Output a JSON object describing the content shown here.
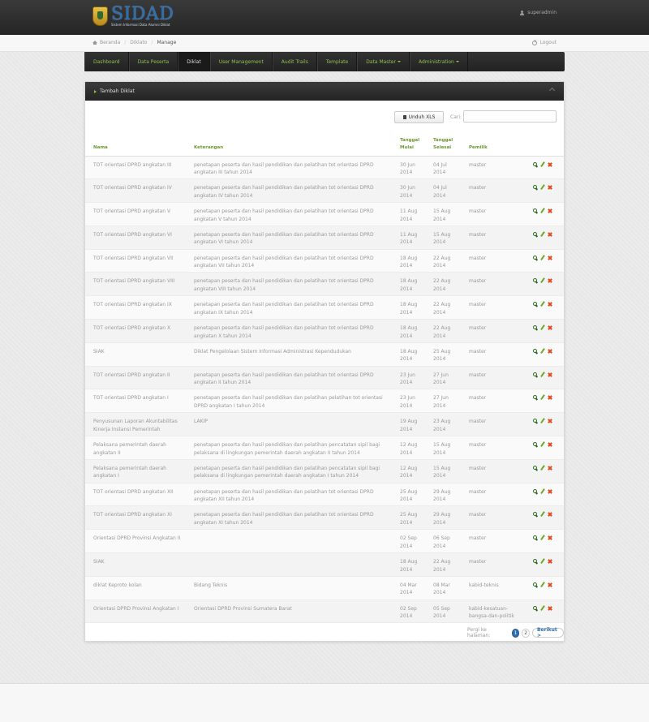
{
  "app": {
    "logo_title": "SIDAD",
    "logo_subtitle": "Sistem Informasi Data Alumni Diklat",
    "user": "superadmin"
  },
  "breadcrumb": {
    "home": "Beranda",
    "section": "Diklato",
    "current": "Manage",
    "logout": "Logout"
  },
  "nav": [
    {
      "label": "Dashboard",
      "active": false
    },
    {
      "label": "Data Peserta",
      "active": false
    },
    {
      "label": "Diklat",
      "active": true
    },
    {
      "label": "User Management",
      "active": false
    },
    {
      "label": "Audit Trails",
      "active": false
    },
    {
      "label": "Template",
      "active": false
    },
    {
      "label": "Data Master",
      "active": false,
      "dropdown": true
    },
    {
      "label": "Administration",
      "active": false,
      "dropdown": true
    }
  ],
  "panel": {
    "title": "Tambah Diklat",
    "export_label": "Unduh XLS",
    "search_label": "Cari:",
    "search_value": ""
  },
  "table": {
    "headers": {
      "nama": "Nama",
      "keterangan": "Keterangan",
      "tgl_mulai": "Tanggal Mulai",
      "tgl_selesai": "Tanggal Selesai",
      "pemilik": "Pemilik"
    },
    "rows": [
      {
        "nama": "TOT orientasi DPRD angkatan III",
        "keterangan": "penetapan peserta dan hasil pendidikan dan pelatihan tot orientasi DPRD angkatan III tahun 2014",
        "mulai": "30 Jun 2014",
        "selesai": "04 Jul 2014",
        "pemilik": "master"
      },
      {
        "nama": "TOT orientasi DPRD angkatan IV",
        "keterangan": "penetapan peserta dan hasil pendidikan dan pelatihan tot orientasi DPRD angkatan IV tahun 2014",
        "mulai": "30 Jun 2014",
        "selesai": "04 Jul 2014",
        "pemilik": "master"
      },
      {
        "nama": "TOT orientasi DPRD angkatan V",
        "keterangan": "penetapan peserta dan hasil pendidikan dan pelatihan tot orientasi DPRD angkatan V tahun 2014",
        "mulai": "11 Aug 2014",
        "selesai": "15 Aug 2014",
        "pemilik": "master"
      },
      {
        "nama": "TOT orientasi DPRD angkatan VI",
        "keterangan": "penetapan peserta dan hasil pendidikan dan pelatihan tot orientasi DPRD angkatan VI tahun 2014",
        "mulai": "11 Aug 2014",
        "selesai": "15 Aug 2014",
        "pemilik": "master"
      },
      {
        "nama": "TOT orientasi DPRD angkatan VII",
        "keterangan": "penetapan peserta dan hasil pendidikan dan pelatihan tot orientasi DPRD angkatan VII tahun 2014",
        "mulai": "18 Aug 2014",
        "selesai": "22 Aug 2014",
        "pemilik": "master"
      },
      {
        "nama": "TOT orientasi DPRD angkatan VIII",
        "keterangan": "penetapan peserta dan hasil pendidikan dan pelatihan tot orientasi DPRD angkatan VIII tahun 2014",
        "mulai": "18 Aug 2014",
        "selesai": "22 Aug 2014",
        "pemilik": "master"
      },
      {
        "nama": "TOT orientasi DPRD angkatan IX",
        "keterangan": "penetapan peserta dan hasil pendidikan dan pelatihan tot orientasi DPRD angkatan IX tahun 2014",
        "mulai": "18 Aug 2014",
        "selesai": "22 Aug 2014",
        "pemilik": "master"
      },
      {
        "nama": "TOT orientasi DPRD angkatan X",
        "keterangan": "penetapan peserta dan hasil pendidikan dan pelatihan tot orientasi DPRD angkatan X tahun 2014",
        "mulai": "18 Aug 2014",
        "selesai": "22 Aug 2014",
        "pemilik": "master"
      },
      {
        "nama": "SIAK",
        "keterangan": "Diklat Pengelolaan Sistem Informasi Administrasi Kependudukan",
        "mulai": "18 Aug 2014",
        "selesai": "25 Aug 2014",
        "pemilik": "master"
      },
      {
        "nama": "TOT orientasi DPRD angkatan II",
        "keterangan": "penetapan peserta dan hasil pendidikan dan pelatihan tot orientasi DPRD angkatan II tahun 2014",
        "mulai": "23 Jun 2014",
        "selesai": "27 Jun 2014",
        "pemilik": "master"
      },
      {
        "nama": "TOT orientasi DPRD angkatan I",
        "keterangan": "penetapan peserta dan hasil pendidikan dan pelatihan pelatihan tot orientasi DPRD angkatan I tahun 2014",
        "mulai": "23 Jun 2014",
        "selesai": "27 Jun 2014",
        "pemilik": "master"
      },
      {
        "nama": "Penyusunan Laporan Akuntabilitas Kinerja Instansi Pemerintah",
        "keterangan": "LAKIP",
        "mulai": "19 Aug 2014",
        "selesai": "23 Aug 2014",
        "pemilik": "master"
      },
      {
        "nama": "Pelaksana pemerintah daerah angkatan II",
        "keterangan": "penetapan peserta dan hasil pendidikan dan pelatihan pencatatan sipil bagi pelaksana di lingkungan pemerintah daerah angkatan II tahun 2014",
        "mulai": "12 Aug 2014",
        "selesai": "15 Aug 2014",
        "pemilik": "master"
      },
      {
        "nama": "Pelaksana pemerintah daerah angkatan I",
        "keterangan": "penetapan peserta dan hasil pendidikan dan pelatihan pencatatan sipil bagi pelaksana di lingkungan pemerintah daerah angkatan I tahun 2014",
        "mulai": "12 Aug 2014",
        "selesai": "15 Aug 2014",
        "pemilik": "master"
      },
      {
        "nama": "TOT orientasi DPRD angkatan XII",
        "keterangan": "penetapan peserta dan hasil pendidikan dan pelatihan tot orientasi DPRD angkatan XII tahun 2014",
        "mulai": "25 Aug 2014",
        "selesai": "29 Aug 2014",
        "pemilik": "master"
      },
      {
        "nama": "TOT orientasi DPRD angkatan XI",
        "keterangan": "penetapan peserta dan hasil pendidikan dan pelatihan tot orientasi DPRD angkatan XI tahun 2014",
        "mulai": "25 Aug 2014",
        "selesai": "29 Aug 2014",
        "pemilik": "master"
      },
      {
        "nama": "Orientasi DPRD Provinsi Angkatan II",
        "keterangan": "",
        "mulai": "02 Sep 2014",
        "selesai": "06 Sep 2014",
        "pemilik": "master"
      },
      {
        "nama": "SIAK",
        "keterangan": "",
        "mulai": "18 Aug 2014",
        "selesai": "22 Aug 2014",
        "pemilik": "master"
      },
      {
        "nama": "diklat Keproto kolan",
        "keterangan": "Bidang Teknis",
        "mulai": "04 Mar 2014",
        "selesai": "08 Mar 2014",
        "pemilik": "kabid-teknis"
      },
      {
        "nama": "Orientasi DPRD Provinsi Angkatan I",
        "keterangan": "Orientasi DPRD Provinsi Sumatera Barat",
        "mulai": "02 Sep 2014",
        "selesai": "05 Sep 2014",
        "pemilik": "kabid-kesatuan-bangsa-dan-politik"
      }
    ]
  },
  "pagination": {
    "label": "Pergi ke halaman:",
    "pages": [
      "1",
      "2"
    ],
    "current": "1",
    "next": "Berikut >"
  },
  "icons": {
    "view": "magnifier-icon",
    "edit": "pencil-icon",
    "delete": "cross-icon"
  },
  "colors": {
    "accent_green": "#8cc04f",
    "header_green": "#6b9a2f",
    "pager_blue": "#2f6fb0",
    "delete_red": "#e0491e"
  }
}
